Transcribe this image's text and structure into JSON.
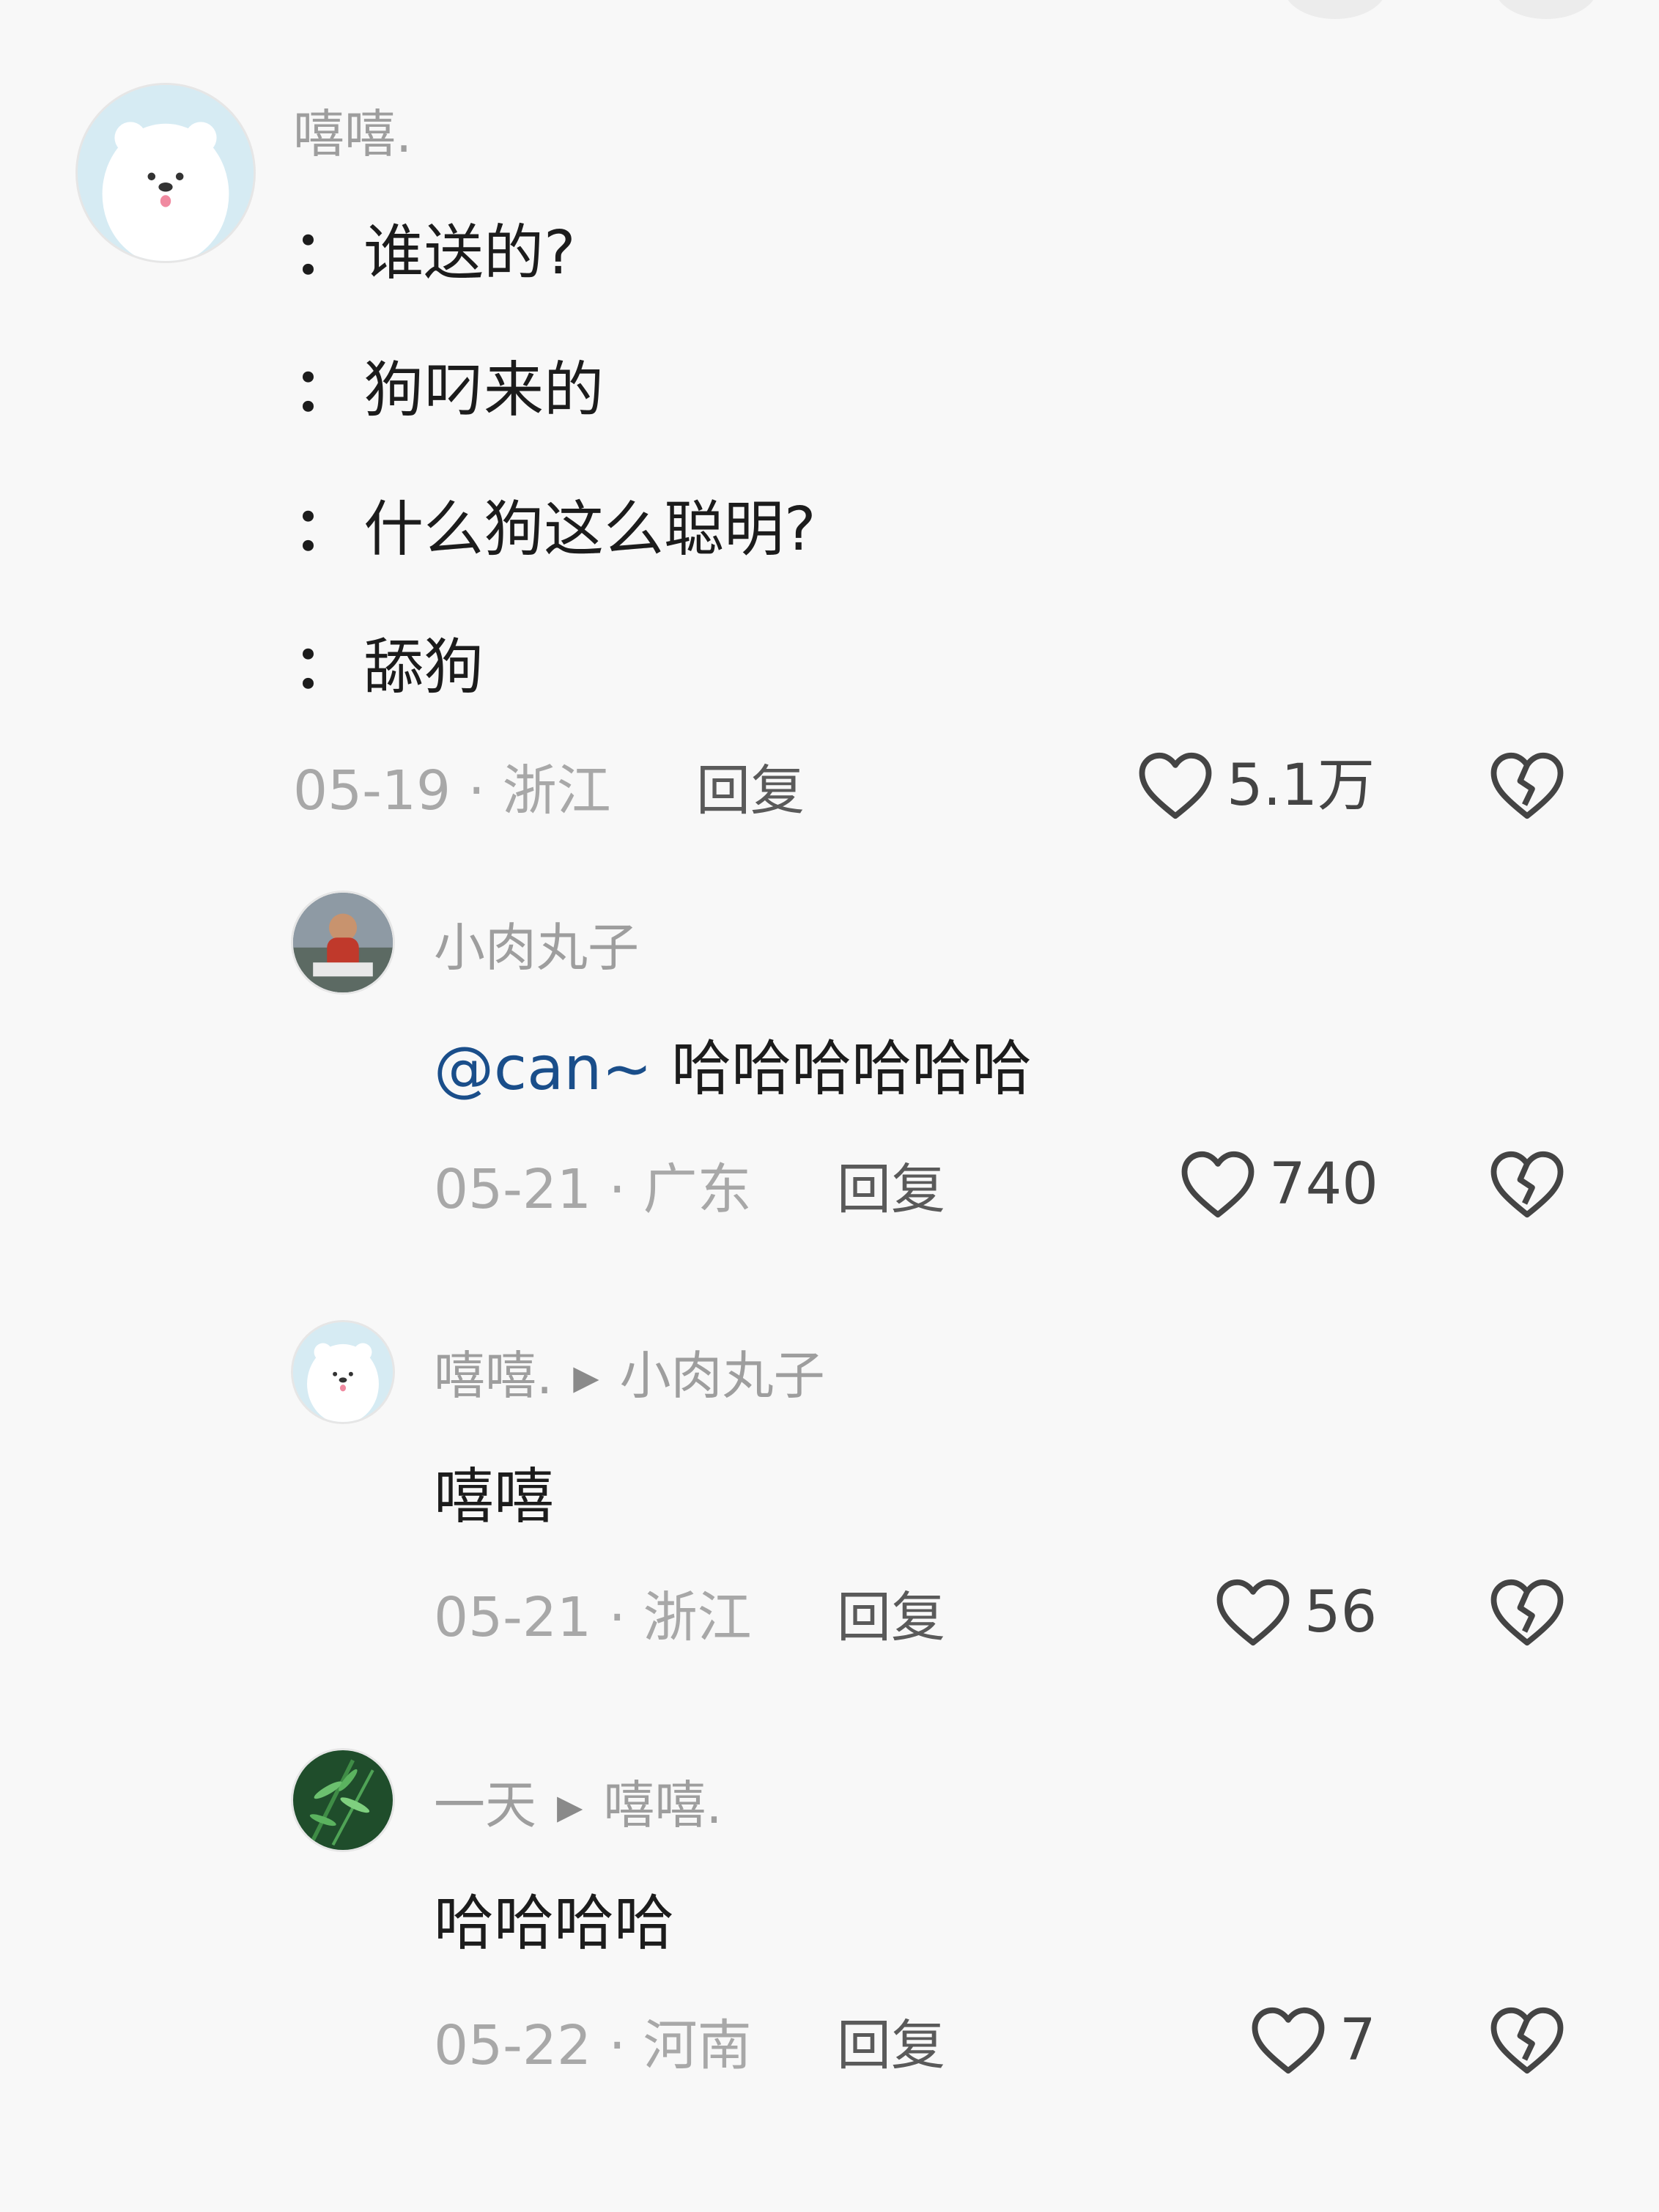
{
  "comment": {
    "username": "嘻嘻.",
    "lines": [
      "谁送的?",
      "狗叼来的",
      "什么狗这么聪明?",
      "舔狗"
    ],
    "colon": "：",
    "date": "05-19",
    "location": "浙江",
    "reply_label": "回复",
    "likes": "5.1万"
  },
  "replies": [
    {
      "username": "小肉丸子",
      "mention": "@can~",
      "text": "哈哈哈哈哈哈",
      "date": "05-21",
      "location": "广东",
      "reply_label": "回复",
      "likes": "740"
    },
    {
      "username": "嘻嘻.",
      "reply_to": "小肉丸子",
      "text": "嘻嘻",
      "date": "05-21",
      "location": "浙江",
      "reply_label": "回复",
      "likes": "56"
    },
    {
      "username": "一天",
      "reply_to": "嘻嘻.",
      "text": "哈哈哈哈",
      "date": "05-22",
      "location": "河南",
      "reply_label": "回复",
      "likes": "7"
    }
  ],
  "meta_separator": " · ",
  "reply_arrow": "▶",
  "icons": {
    "like": "heart-outline-icon",
    "dislike": "broken-heart-icon"
  },
  "colors": {
    "mention": "#1a4e8a",
    "meta": "#a8a8a8",
    "username": "#9e9e9e"
  }
}
